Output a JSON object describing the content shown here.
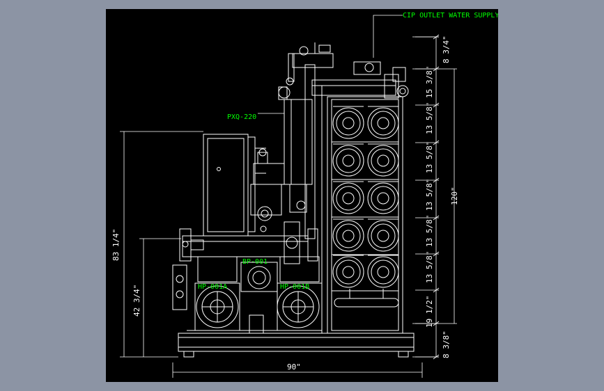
{
  "labels": {
    "cip_outlet": "CIP OUTLET WATER SUPPLY",
    "pxq": "PXQ-220",
    "pump_a": "HP-001A",
    "pump_b": "HP-001B",
    "booster": "BP-001"
  },
  "dimensions": {
    "right": [
      "8 3/4\"",
      "15 3/8\"",
      "13 5/8\"",
      "13 5/8\"",
      "13 5/8\"",
      "13 5/8\"",
      "13 5/8\"",
      "19 1/2\"",
      "8 3/8\""
    ],
    "total_height": "120\"",
    "left_upper": "83 1/4\"",
    "left_lower": "42 3/4\"",
    "bottom_width": "90\""
  },
  "colors": {
    "background": "#8c94a4",
    "canvas": "#000000",
    "line": "#ffffff",
    "text": "#00ff00"
  }
}
